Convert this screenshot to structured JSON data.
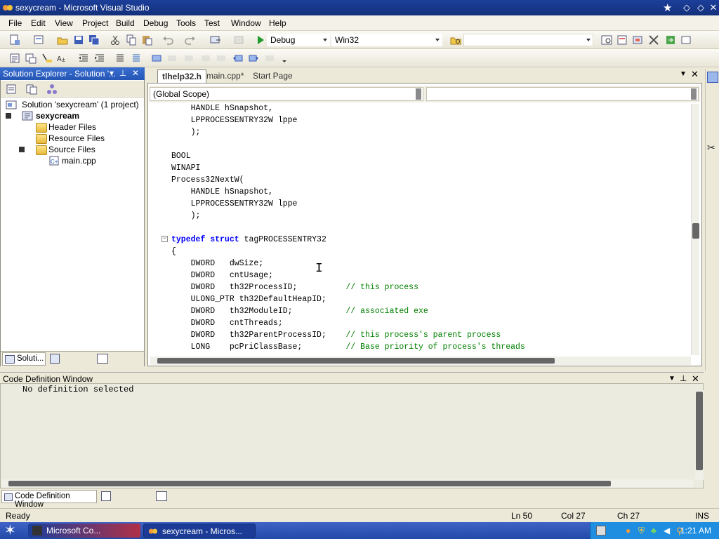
{
  "window": {
    "title": "sexycream - Microsoft Visual Studio"
  },
  "menus": [
    "File",
    "Edit",
    "View",
    "Project",
    "Build",
    "Debug",
    "Tools",
    "Test",
    "Window",
    "Help"
  ],
  "toolbar": {
    "config": "Debug",
    "platform": "Win32"
  },
  "solution_explorer": {
    "title": "Solution Explorer - Solution '...",
    "items": [
      {
        "label": "Solution 'sexycream' (1 project)"
      },
      {
        "label": "sexycream"
      },
      {
        "label": "Header Files"
      },
      {
        "label": "Resource Files"
      },
      {
        "label": "Source Files"
      },
      {
        "label": "main.cpp"
      }
    ],
    "bottom_tab": "Soluti..."
  },
  "editor": {
    "tabs": [
      "tlhelp32.h",
      "main.cpp*",
      "Start Page"
    ],
    "scope": "(Global Scope)",
    "lines": [
      {
        "code": "    HANDLE hSnapshot,",
        "comment": ""
      },
      {
        "code": "    LPPROCESSENTRY32W lppe",
        "comment": ""
      },
      {
        "code": "    );",
        "comment": ""
      },
      {
        "code": "",
        "comment": ""
      },
      {
        "code": "BOOL",
        "comment": ""
      },
      {
        "code": "WINAPI",
        "comment": ""
      },
      {
        "code": "Process32NextW(",
        "comment": ""
      },
      {
        "code": "    HANDLE hSnapshot,",
        "comment": ""
      },
      {
        "code": "    LPPROCESSENTRY32W lppe",
        "comment": ""
      },
      {
        "code": "    );",
        "comment": ""
      },
      {
        "code": "",
        "comment": ""
      },
      {
        "code": "typedef struct tagPROCESSENTRY32",
        "comment": "",
        "kw": [
          "typedef",
          "struct"
        ]
      },
      {
        "code": "{",
        "comment": ""
      },
      {
        "code": "    DWORD   dwSize;",
        "comment": ""
      },
      {
        "code": "    DWORD   cntUsage;",
        "comment": ""
      },
      {
        "code": "    DWORD   th32ProcessID;          ",
        "comment": "// this process"
      },
      {
        "code": "    ULONG_PTR th32DefaultHeapID;",
        "comment": ""
      },
      {
        "code": "    DWORD   th32ModuleID;           ",
        "comment": "// associated exe"
      },
      {
        "code": "    DWORD   cntThreads;",
        "comment": ""
      },
      {
        "code": "    DWORD   th32ParentProcessID;    ",
        "comment": "// this process's parent process"
      },
      {
        "code": "    LONG    pcPriClassBase;         ",
        "comment": "// Base priority of process's threads"
      }
    ]
  },
  "code_definition": {
    "title": "Code Definition Window",
    "text": "No definition selected",
    "tab": "Code Definition Window"
  },
  "status": {
    "ready": "Ready",
    "ln": "Ln 50",
    "col": "Col 27",
    "ch": "Ch 27",
    "mode": "INS"
  },
  "taskbar": {
    "task1": "Microsoft Co...",
    "task2": "sexycream - Micros...",
    "clock": "1:21 AM"
  }
}
